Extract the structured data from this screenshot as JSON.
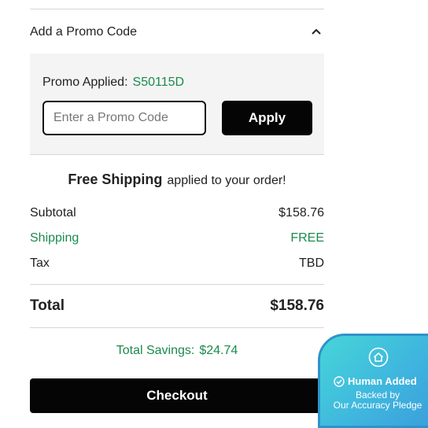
{
  "promo": {
    "header_label": "Add a Promo Code",
    "applied_label": "Promo Applied:",
    "applied_code": "S50115D",
    "input_value": "",
    "input_placeholder": "Enter a Promo Code",
    "apply_label": "Apply"
  },
  "shipping_message": {
    "strong": "Free Shipping",
    "rest": "applied to your order!"
  },
  "summary": {
    "rows": [
      {
        "label": "Subtotal",
        "value": "$158.76"
      },
      {
        "label": "Shipping",
        "value": "FREE"
      },
      {
        "label": "Tax",
        "value": "TBD"
      }
    ],
    "total_label": "Total",
    "total_value": "$158.76",
    "savings_label": "Total Savings:",
    "savings_value": "$24.74"
  },
  "checkout_label": "Checkout",
  "badge": {
    "title": "Human Added",
    "line1": "Backed by",
    "line2": "Our Accuracy Pledge",
    "icon": "home-icon"
  },
  "colors": {
    "accent_green": "#1b8a4d",
    "button_black": "#050505",
    "panel_bg": "#f4f4f4",
    "badge_teal": "#46d6d8"
  }
}
